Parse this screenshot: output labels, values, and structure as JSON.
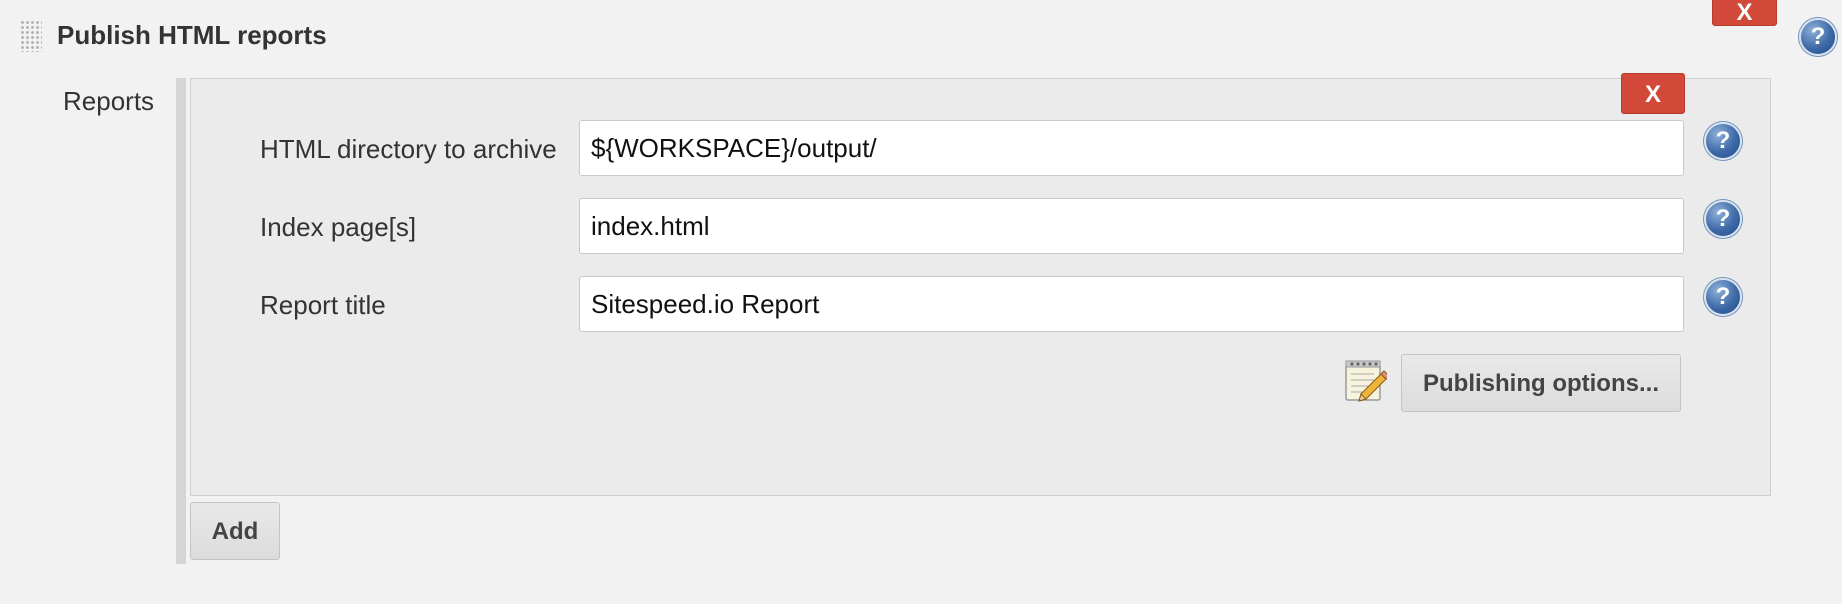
{
  "section": {
    "title": "Publish HTML reports",
    "delete_label": "X"
  },
  "help_glyph": "?",
  "reports": {
    "label": "Reports",
    "delete_label": "X",
    "fields": [
      {
        "label": "HTML directory to archive",
        "value": "${WORKSPACE}/output/"
      },
      {
        "label": "Index page[s]",
        "value": "index.html"
      },
      {
        "label": "Report title",
        "value": "Sitespeed.io Report"
      }
    ],
    "publishing_options_label": "Publishing options...",
    "add_label": "Add"
  },
  "icons": {
    "drag_handle": "drag-handle-icon",
    "help": "help-icon",
    "notepad": "notepad-pencil-icon"
  },
  "colors": {
    "delete": "#d24939",
    "help": "#3e6aa8",
    "background": "#f2f2f2",
    "panel": "#ebebeb"
  }
}
